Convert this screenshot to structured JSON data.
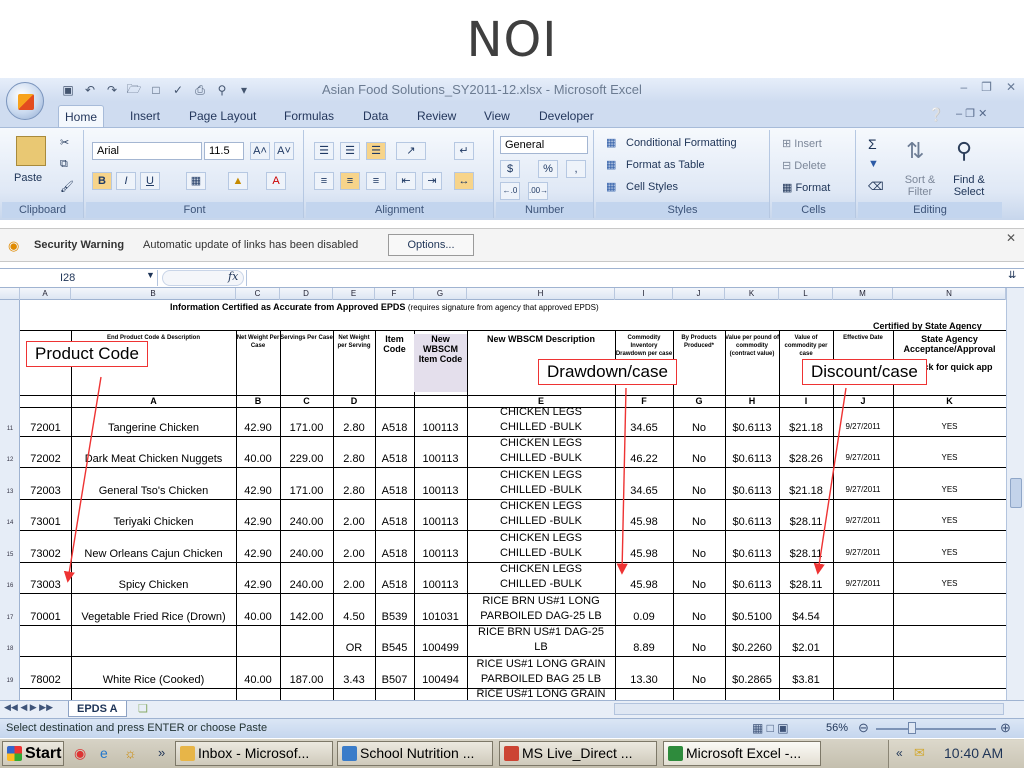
{
  "slide_title": "NOI",
  "window": {
    "title": "Asian Food Solutions_SY2011-12.xlsx - Microsoft Excel"
  },
  "tabs": [
    "Home",
    "Insert",
    "Page Layout",
    "Formulas",
    "Data",
    "Review",
    "View",
    "Developer"
  ],
  "ribbon": {
    "clipboard": {
      "label": "Clipboard",
      "paste": "Paste"
    },
    "font": {
      "label": "Font",
      "name": "Arial",
      "size": "11.5"
    },
    "alignment": {
      "label": "Alignment"
    },
    "number": {
      "label": "Number",
      "format": "General",
      "currency": "$",
      "percent": "%",
      "comma": ","
    },
    "styles": {
      "label": "Styles",
      "conditional": "Conditional Formatting",
      "format_table": "Format as Table",
      "cell_styles": "Cell Styles"
    },
    "cells": {
      "label": "Cells",
      "insert": "Insert",
      "delete": "Delete",
      "format": "Format"
    },
    "editing": {
      "label": "Editing",
      "sort": "Sort & Filter",
      "find": "Find & Select"
    }
  },
  "security": {
    "title": "Security Warning",
    "message": "Automatic update of links has been disabled",
    "options": "Options..."
  },
  "formula": {
    "name_box": "I28",
    "fx": "fx",
    "value": ""
  },
  "columns": [
    "A",
    "B",
    "C",
    "D",
    "E",
    "F",
    "G",
    "H",
    "I",
    "J",
    "K",
    "L",
    "M",
    "N"
  ],
  "sheet": {
    "banner": "Information Certified as Accurate from Approved EPDS",
    "banner_note": "(requires signature from agency that approved EPDS)",
    "certified": "Certified by State Agency",
    "headers": {
      "b": "End Product Code & Description",
      "c": "Net Weight Per Case",
      "d": "Servings Per Case",
      "e": "Net Weight per Serving",
      "f": "Item Code",
      "g": "New WBSCM Item Code",
      "h": "New WBSCM Description",
      "i": "Commodity Inventory Drawdown per case",
      "j": "By Products Produced*",
      "k": "Value per pound of commodity (contract value)",
      "l": "Value of commodity per case",
      "m": "Effective Date",
      "n": "State Agency Acceptance/Approval",
      "n2": "Check for quick app"
    },
    "letters": [
      "A",
      "B",
      "C",
      "D",
      "E",
      "F",
      "G",
      "H",
      "I",
      "J",
      "K"
    ],
    "rows": [
      {
        "num": "11",
        "code": "72001",
        "name": "Tangerine Chicken",
        "netwt": "42.90",
        "serv": "171.00",
        "nps": "2.80",
        "item": "A518",
        "wbscm": "100113",
        "desc1": "CHICKEN LEGS",
        "desc2": "CHILLED -BULK",
        "draw": "34.65",
        "by": "No",
        "vpp": "$0.6113",
        "vpc": "$21.18",
        "date": "9/27/2011",
        "ok": "YES"
      },
      {
        "num": "12",
        "code": "72002",
        "name": "Dark Meat Chicken Nuggets",
        "netwt": "40.00",
        "serv": "229.00",
        "nps": "2.80",
        "item": "A518",
        "wbscm": "100113",
        "desc1": "CHICKEN LEGS",
        "desc2": "CHILLED -BULK",
        "draw": "46.22",
        "by": "No",
        "vpp": "$0.6113",
        "vpc": "$28.26",
        "date": "9/27/2011",
        "ok": "YES"
      },
      {
        "num": "13",
        "code": "72003",
        "name": "General Tso's Chicken",
        "netwt": "42.90",
        "serv": "171.00",
        "nps": "2.80",
        "item": "A518",
        "wbscm": "100113",
        "desc1": "CHICKEN LEGS",
        "desc2": "CHILLED -BULK",
        "draw": "34.65",
        "by": "No",
        "vpp": "$0.6113",
        "vpc": "$21.18",
        "date": "9/27/2011",
        "ok": "YES"
      },
      {
        "num": "14",
        "code": "73001",
        "name": "Teriyaki Chicken",
        "netwt": "42.90",
        "serv": "240.00",
        "nps": "2.00",
        "item": "A518",
        "wbscm": "100113",
        "desc1": "CHICKEN LEGS",
        "desc2": "CHILLED -BULK",
        "draw": "45.98",
        "by": "No",
        "vpp": "$0.6113",
        "vpc": "$28.11",
        "date": "9/27/2011",
        "ok": "YES"
      },
      {
        "num": "15",
        "code": "73002",
        "name": "New Orleans Cajun Chicken",
        "netwt": "42.90",
        "serv": "240.00",
        "nps": "2.00",
        "item": "A518",
        "wbscm": "100113",
        "desc1": "CHICKEN LEGS",
        "desc2": "CHILLED -BULK",
        "draw": "45.98",
        "by": "No",
        "vpp": "$0.6113",
        "vpc": "$28.11",
        "date": "9/27/2011",
        "ok": "YES"
      },
      {
        "num": "16",
        "code": "73003",
        "name": "Spicy Chicken",
        "netwt": "42.90",
        "serv": "240.00",
        "nps": "2.00",
        "item": "A518",
        "wbscm": "100113",
        "desc1": "CHICKEN LEGS",
        "desc2": "CHILLED -BULK",
        "draw": "45.98",
        "by": "No",
        "vpp": "$0.6113",
        "vpc": "$28.11",
        "date": "9/27/2011",
        "ok": "YES"
      },
      {
        "num": "17",
        "code": "70001",
        "name": "Vegetable Fried Rice (Drown)",
        "netwt": "40.00",
        "serv": "142.00",
        "nps": "4.50",
        "item": "B539",
        "wbscm": "101031",
        "desc1": "RICE BRN US#1 LONG",
        "desc2": "PARBOILED DAG-25 LB",
        "draw": "0.09",
        "by": "No",
        "vpp": "$0.5100",
        "vpc": "$4.54",
        "date": "",
        "ok": ""
      },
      {
        "num": "18",
        "code": "",
        "name": "",
        "netwt": "",
        "serv": "",
        "nps": "OR",
        "item": "B545",
        "wbscm": "100499",
        "desc1": "RICE BRN US#1 DAG-25",
        "desc2": "LB",
        "draw": "8.89",
        "by": "No",
        "vpp": "$0.2260",
        "vpc": "$2.01",
        "date": "",
        "ok": ""
      },
      {
        "num": "19",
        "code": "78002",
        "name": "White Rice (Cooked)",
        "netwt": "40.00",
        "serv": "187.00",
        "nps": "3.43",
        "item": "B507",
        "wbscm": "100494",
        "desc1": "RICE US#1 LONG GRAIN",
        "desc2": "PARBOILED BAG 25 LB",
        "draw": "13.30",
        "by": "No",
        "vpp": "$0.2865",
        "vpc": "$3.81",
        "date": "",
        "ok": ""
      }
    ],
    "partial_row": "RICE US#1 LONG GRAIN"
  },
  "callouts": {
    "product_code": "Product Code",
    "drawdown": "Drawdown/case",
    "discount": "Discount/case"
  },
  "sheet_tab": "EPDS A",
  "status": {
    "message": "Select destination and press ENTER or choose Paste",
    "zoom": "56%"
  },
  "taskbar": {
    "start": "Start",
    "items": [
      "Inbox - Microsof...",
      "School Nutrition ...",
      "MS Live_Direct ...",
      "Microsoft Excel -..."
    ],
    "time": "10:40 AM"
  }
}
